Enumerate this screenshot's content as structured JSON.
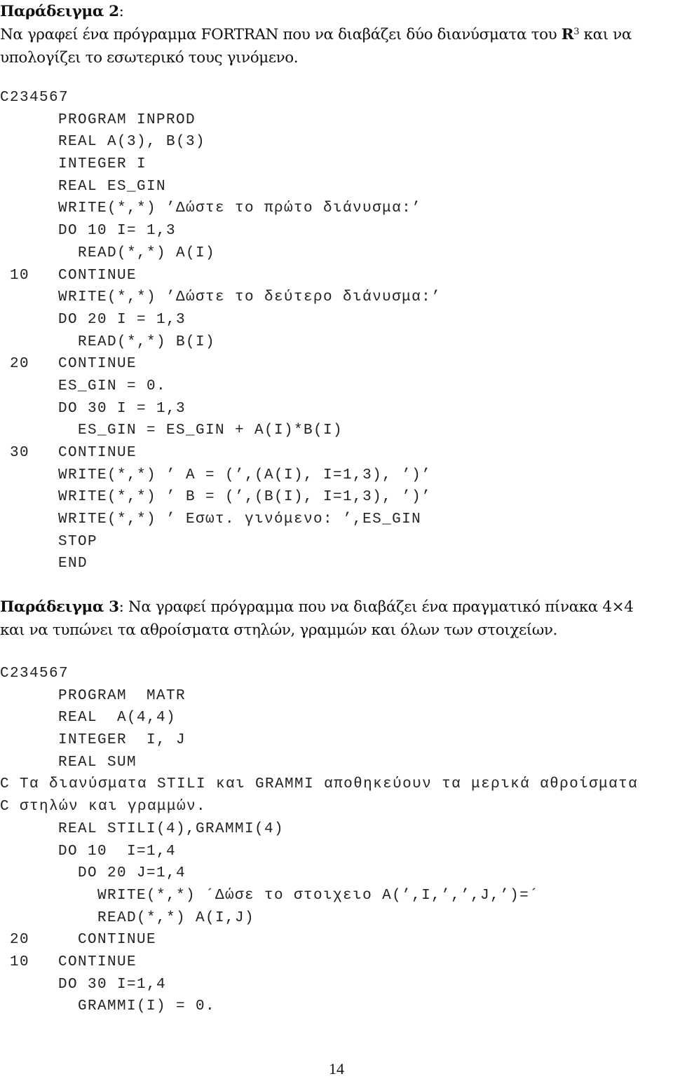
{
  "example2": {
    "heading": "Παράδειγμα 2",
    "heading_suffix": ":",
    "description_line1_before": "Να γραφεί ένα πρόγραμμα FORTRAN που να διαβάζει δύο διανύσματα του ",
    "description_bold_symbol": "R",
    "description_superscript": "3",
    "description_line1_after": " και να",
    "description_line2": "υπολογίζει το εσωτερικό τους γινόμενο.",
    "code": [
      {
        "label": "",
        "text": "C234567",
        "full": true
      },
      {
        "label": "",
        "text": "PROGRAM INPROD"
      },
      {
        "label": "",
        "text": "REAL A(3), B(3)"
      },
      {
        "label": "",
        "text": "INTEGER I"
      },
      {
        "label": "",
        "text": "REAL ES_GIN"
      },
      {
        "label": "",
        "text": "WRITE(*,*) ’Δώστε το πρώτο διάνυσμα:’"
      },
      {
        "label": "",
        "text": "DO 10 I= 1,3"
      },
      {
        "label": "",
        "text": "  READ(*,*) A(I)"
      },
      {
        "label": "10",
        "text": "CONTINUE"
      },
      {
        "label": "",
        "text": "WRITE(*,*) ’Δώστε το δεύτερο διάνυσμα:’"
      },
      {
        "label": "",
        "text": "DO 20 I = 1,3"
      },
      {
        "label": "",
        "text": "  READ(*,*) B(I)"
      },
      {
        "label": "20",
        "text": "CONTINUE"
      },
      {
        "label": "",
        "text": "ES_GIN = 0."
      },
      {
        "label": "",
        "text": "DO 30 I = 1,3"
      },
      {
        "label": "",
        "text": "  ES_GIN = ES_GIN + A(I)*B(I)"
      },
      {
        "label": "30",
        "text": "CONTINUE"
      },
      {
        "label": "",
        "text": "WRITE(*,*) ’ A = (’,(A(I), I=1,3), ’)’"
      },
      {
        "label": "",
        "text": "WRITE(*,*) ’ B = (’,(B(I), I=1,3), ’)’"
      },
      {
        "label": "",
        "text": "WRITE(*,*) ’ Εσωτ. γινόμενο: ’,ES_GIN"
      },
      {
        "label": "",
        "text": "STOP"
      },
      {
        "label": "",
        "text": "END"
      }
    ]
  },
  "example3": {
    "heading": "Παράδειγμα 3",
    "heading_suffix": ":",
    "description_line1": " Να γραφεί πρόγραμμα που να διαβάζει ένα πραγματικό πίνακα 4×4",
    "description_line2": "και να τυπώνει τα αθροίσματα στηλών, γραμμών και όλων των στοιχείων.",
    "code": [
      {
        "label": "",
        "text": "C234567",
        "full": true
      },
      {
        "label": "",
        "text": "PROGRAM  MATR"
      },
      {
        "label": "",
        "text": "REAL  A(4,4)"
      },
      {
        "label": "",
        "text": "INTEGER  I, J"
      },
      {
        "label": "",
        "text": "REAL SUM"
      },
      {
        "label": "",
        "text": "C Τα διανύσματα STILI και GRAMMI αποθηκεύουν τα μερικά αθροίσματα",
        "full": true
      },
      {
        "label": "",
        "text": "C στηλών και γραμμών.",
        "full": true
      },
      {
        "label": "",
        "text": "REAL STILI(4),GRAMMI(4)"
      },
      {
        "label": "",
        "text": "DO 10  I=1,4"
      },
      {
        "label": "",
        "text": "  DO 20 J=1,4"
      },
      {
        "label": "",
        "text": "    WRITE(*,*) ´Δώσε το στοιχειο A(’,I,’,’,J,’)=´"
      },
      {
        "label": "",
        "text": "    READ(*,*) A(I,J)"
      },
      {
        "label": "20",
        "text": "  CONTINUE"
      },
      {
        "label": "10",
        "text": "CONTINUE"
      },
      {
        "label": "",
        "text": "DO 30 I=1,4"
      },
      {
        "label": "",
        "text": "  GRAMMI(I) = 0."
      }
    ]
  },
  "footer": {
    "page_number": "14"
  }
}
